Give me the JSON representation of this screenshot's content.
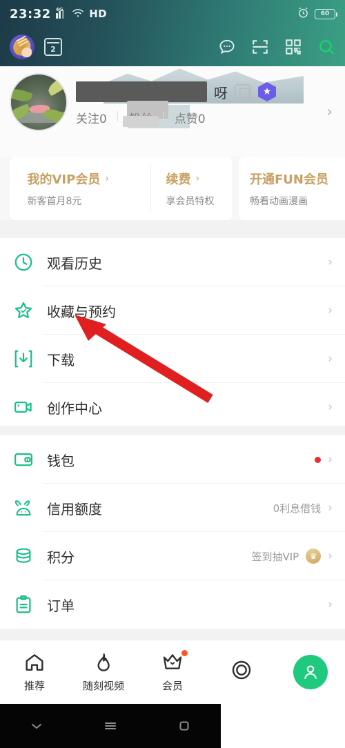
{
  "status_bar": {
    "time": "23:32",
    "network": "4G",
    "hd": "HD",
    "battery": "60",
    "alarm_icon": "alarm-clock-icon",
    "wifi_icon": "wifi-icon",
    "signal_icon": "signal-bars-icon"
  },
  "header": {
    "avatar_icon": "user-avatar-guitar",
    "calendar_day": "2",
    "icons": [
      {
        "name": "message-icon"
      },
      {
        "name": "scan-icon"
      },
      {
        "name": "qrcode-icon"
      },
      {
        "name": "search-icon"
      }
    ],
    "gradient_from": "#1d3a47",
    "gradient_to": "#3ba084"
  },
  "profile": {
    "username_visible_tail": "呀",
    "username_redacted": true,
    "edit_icon": "camera-edit-icon",
    "badge_icon": "star-badge-icon",
    "badge_color": "#6c5ce7",
    "stats": [
      {
        "label": "关注0"
      },
      {
        "label": "粉丝"
      },
      {
        "label": "点赞0"
      }
    ],
    "chevron": "›"
  },
  "vip_cards": [
    {
      "title": "我的VIP会员",
      "chevron": "›",
      "subtitle": "新客首月8元"
    },
    {
      "title": "续费",
      "chevron": "›",
      "subtitle": "享会员特权"
    },
    {
      "title": "开通FUN会员",
      "chevron": "",
      "subtitle": "畅看动画漫画"
    }
  ],
  "menu_group_1": [
    {
      "label": "观看历史",
      "icon": "clock-icon",
      "hint": "",
      "chevron": "›",
      "dot": false,
      "crown": false
    },
    {
      "label": "收藏与预约",
      "icon": "star-icon",
      "hint": "",
      "chevron": "›",
      "dot": false,
      "crown": false
    },
    {
      "label": "下载",
      "icon": "download-icon",
      "hint": "",
      "chevron": "›",
      "dot": false,
      "crown": false
    },
    {
      "label": "创作中心",
      "icon": "video-camera-icon",
      "hint": "",
      "chevron": "›",
      "dot": false,
      "crown": false
    }
  ],
  "menu_group_2": [
    {
      "label": "钱包",
      "icon": "wallet-icon",
      "hint": "",
      "chevron": "›",
      "dot": true,
      "crown": false
    },
    {
      "label": "信用额度",
      "icon": "rabbit-icon",
      "hint": "0利息借钱",
      "chevron": "›",
      "dot": false,
      "crown": false
    },
    {
      "label": "积分",
      "icon": "coins-icon",
      "hint": "签到抽VIP",
      "chevron": "›",
      "dot": false,
      "crown": true
    },
    {
      "label": "订单",
      "icon": "clipboard-icon",
      "hint": "",
      "chevron": "›",
      "dot": false,
      "crown": false
    }
  ],
  "tabbar": [
    {
      "label": "推荐",
      "icon": "home-icon",
      "dot": false,
      "active": false
    },
    {
      "label": "随刻视频",
      "icon": "flame-icon",
      "dot": false,
      "active": false
    },
    {
      "label": "会员",
      "icon": "crown-icon",
      "dot": true,
      "active": true
    },
    {
      "label": "",
      "icon": "circle-target-icon",
      "dot": false,
      "active": false
    },
    {
      "label": "",
      "icon": "profile-avatar-icon",
      "dot": false,
      "active": false
    }
  ],
  "annotation": {
    "type": "red-arrow",
    "color": "#e02020",
    "points_to": "收藏与预约"
  },
  "system_nav": [
    {
      "name": "back-icon"
    },
    {
      "name": "menu-icon"
    },
    {
      "name": "home-square-icon"
    }
  ],
  "theme": {
    "accent_green": "#19c08a",
    "gold": "#c8a063",
    "red_dot": "#ee2b2b"
  }
}
